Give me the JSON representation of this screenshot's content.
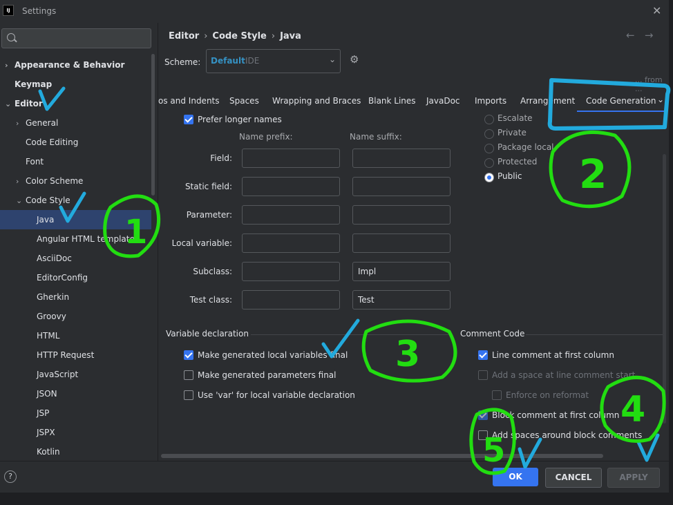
{
  "window": {
    "title": "Settings",
    "logo": "IJ"
  },
  "sidebar": {
    "search_placeholder": "Q-",
    "items": [
      {
        "label": "Appearance & Behavior",
        "arrow": "›"
      },
      {
        "label": "Keymap"
      },
      {
        "label": "Editor",
        "arrow": "⌄"
      },
      {
        "label": "General",
        "arrow": "›"
      },
      {
        "label": "Code Editing"
      },
      {
        "label": "Font"
      },
      {
        "label": "Color Scheme",
        "arrow": "›"
      },
      {
        "label": "Code Style",
        "arrow": "⌄"
      },
      {
        "label": "Java"
      },
      {
        "label": "Angular HTML template"
      },
      {
        "label": "AsciiDoc"
      },
      {
        "label": "EditorConfig"
      },
      {
        "label": "Gherkin"
      },
      {
        "label": "Groovy"
      },
      {
        "label": "HTML"
      },
      {
        "label": "HTTP Request"
      },
      {
        "label": "JavaScript"
      },
      {
        "label": "JSON"
      },
      {
        "label": "JSP"
      },
      {
        "label": "JSPX"
      },
      {
        "label": "Kotlin"
      }
    ]
  },
  "breadcrumb": {
    "parts": [
      "Editor",
      "Code Style",
      "Java"
    ],
    "separator": "›"
  },
  "nav": {
    "back": "←",
    "forward": "→"
  },
  "scheme": {
    "label": "Scheme:",
    "value": "Default",
    "suffix": "IDE"
  },
  "set_from_text": "... from ...",
  "tabs": [
    "os and Indents",
    "Spaces",
    "Wrapping and Braces",
    "Blank Lines",
    "JavaDoc",
    "Imports",
    "Arrangement",
    "Code Generation"
  ],
  "naming": {
    "prefer_longer": "Prefer longer names",
    "prefix_header": "Name prefix:",
    "suffix_header": "Name suffix:",
    "rows": [
      {
        "label": "Field:",
        "prefix": "",
        "suffix": ""
      },
      {
        "label": "Static field:",
        "prefix": "",
        "suffix": ""
      },
      {
        "label": "Parameter:",
        "prefix": "",
        "suffix": ""
      },
      {
        "label": "Local variable:",
        "prefix": "",
        "suffix": ""
      },
      {
        "label": "Subclass:",
        "prefix": "",
        "suffix": "Impl"
      },
      {
        "label": "Test class:",
        "prefix": "",
        "suffix": "Test"
      }
    ]
  },
  "visibility": {
    "options": [
      "Escalate",
      "Private",
      "Package local",
      "Protected",
      "Public"
    ],
    "selected": "Public"
  },
  "variable_declaration": {
    "title": "Variable declaration",
    "options": [
      {
        "label": "Make generated local variables final",
        "checked": true
      },
      {
        "label": "Make generated parameters final",
        "checked": false
      },
      {
        "label": "Use 'var' for local variable declaration",
        "checked": false
      }
    ]
  },
  "comment_code": {
    "title": "Comment Code",
    "options": [
      {
        "label": "Line comment at first column",
        "checked": true
      },
      {
        "label": "Add a space at line comment start",
        "checked": false
      },
      {
        "label": "Enforce on reformat",
        "checked": false
      },
      {
        "label": "Block comment at first column",
        "checked": true
      },
      {
        "label": "Add spaces around block comments",
        "checked": false
      }
    ]
  },
  "footer": {
    "help": "?",
    "ok": "OK",
    "cancel": "CANCEL",
    "apply": "APPLY"
  },
  "annotations": {
    "n1": "1",
    "n2": "2",
    "n3": "3",
    "n4": "4",
    "n5": "5",
    "green": "#22dd11",
    "blue": "#22aadd"
  }
}
